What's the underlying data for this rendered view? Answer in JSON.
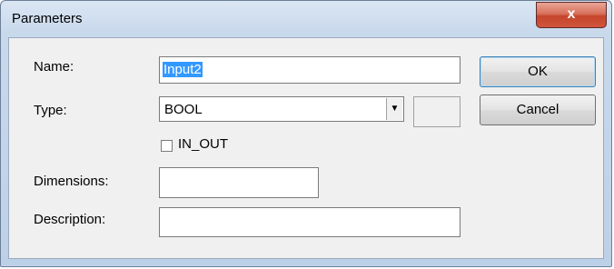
{
  "window": {
    "title": "Parameters",
    "close_label": "x"
  },
  "form": {
    "name_label": "Name:",
    "name_value": "Input2",
    "type_label": "Type:",
    "type_value": "BOOL",
    "inout_label": "IN_OUT",
    "inout_checked": false,
    "dimensions_label": "Dimensions:",
    "dimensions_value": "",
    "description_label": "Description:",
    "description_value": ""
  },
  "buttons": {
    "ok": "OK",
    "cancel": "Cancel"
  },
  "colors": {
    "selection": "#3399ff",
    "close_button": "#c5452b"
  }
}
